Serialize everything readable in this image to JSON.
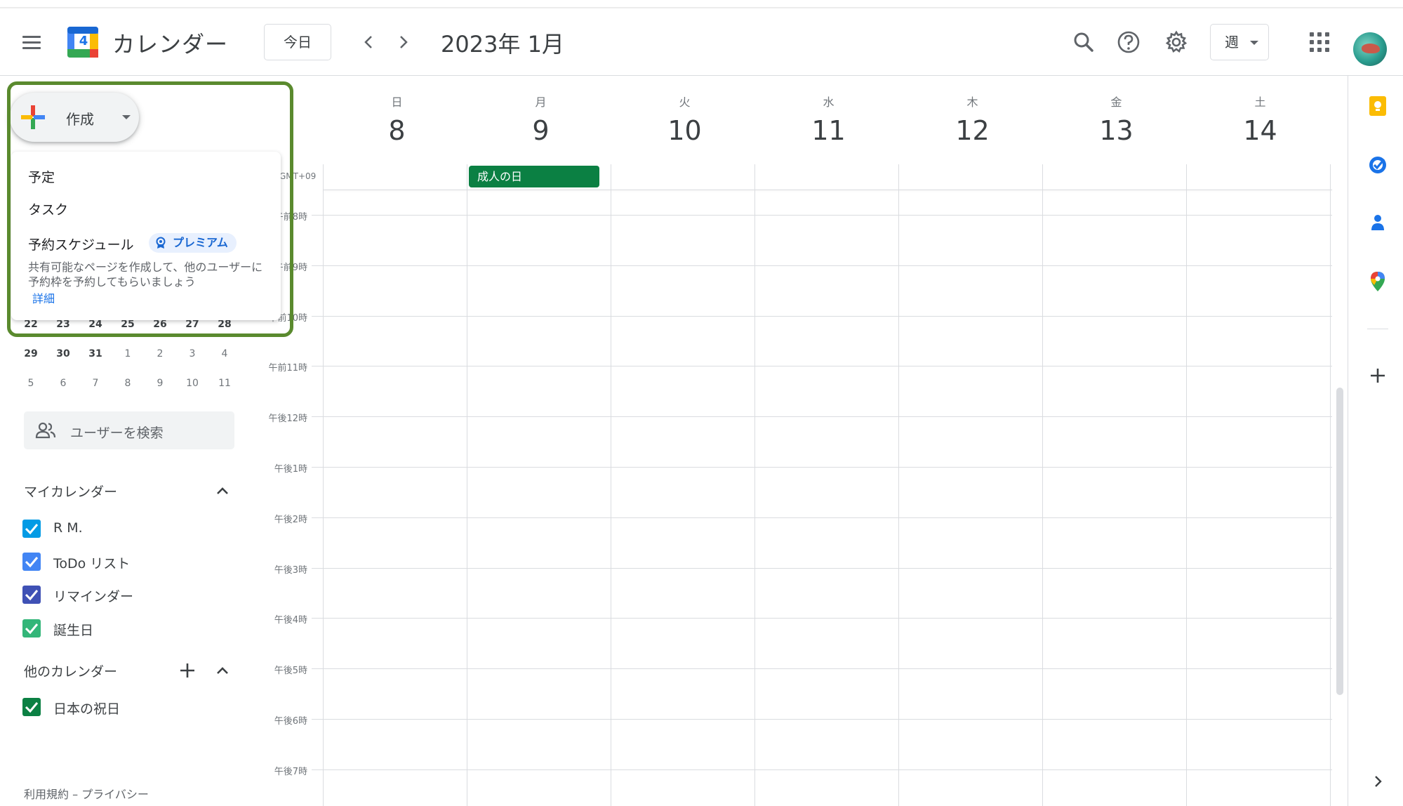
{
  "header": {
    "app_title": "カレンダー",
    "logo_day": "4",
    "today_label": "今日",
    "date_title": "2023年 1月",
    "view_label": "週"
  },
  "create": {
    "button_label": "作成",
    "menu": {
      "event": "予定",
      "task": "タスク",
      "appointment": "予約スケジュール",
      "premium_badge": "プレミアム",
      "description": "共有可能なページを作成して、他のユーザーに予約枠を予約してもらいましょう",
      "learn_more": "詳細"
    }
  },
  "mini_calendar": {
    "rows": [
      [
        "22",
        "23",
        "24",
        "25",
        "26",
        "27",
        "28"
      ],
      [
        "29",
        "30",
        "31",
        "1",
        "2",
        "3",
        "4"
      ],
      [
        "5",
        "6",
        "7",
        "8",
        "9",
        "10",
        "11"
      ]
    ]
  },
  "user_search": {
    "placeholder": "ユーザーを検索"
  },
  "my_calendars": {
    "title": "マイカレンダー",
    "items": [
      {
        "name": "R M.",
        "color": "#039be5"
      },
      {
        "name": "ToDo リスト",
        "color": "#4285f4"
      },
      {
        "name": "リマインダー",
        "color": "#3f51b5"
      },
      {
        "name": "誕生日",
        "color": "#33b679"
      }
    ]
  },
  "other_calendars": {
    "title": "他のカレンダー",
    "items": [
      {
        "name": "日本の祝日",
        "color": "#0b8043"
      }
    ]
  },
  "footer": {
    "links": "利用規約 – プライバシー"
  },
  "week": {
    "days": [
      {
        "dow": "日",
        "num": "8"
      },
      {
        "dow": "月",
        "num": "9"
      },
      {
        "dow": "火",
        "num": "10"
      },
      {
        "dow": "水",
        "num": "11"
      },
      {
        "dow": "木",
        "num": "12"
      },
      {
        "dow": "金",
        "num": "13"
      },
      {
        "dow": "土",
        "num": "14"
      }
    ],
    "timezone": "GMT+09",
    "hours": [
      "午前8時",
      "午前9時",
      "午前10時",
      "午前11時",
      "午後12時",
      "午後1時",
      "午後2時",
      "午後3時",
      "午後4時",
      "午後5時",
      "午後6時",
      "午後7時"
    ],
    "all_day_event": {
      "title": "成人の日",
      "day": "月",
      "color": "#0b8043"
    }
  },
  "colors": {
    "accent": "#1a73e8",
    "highlight_border": "#5a8a2e",
    "holiday_event": "#0b8043"
  },
  "side_panel": {
    "icons": [
      "keep-icon",
      "tasks-icon",
      "contacts-icon",
      "maps-icon",
      "add-addon-icon",
      "expand-panel-icon"
    ]
  }
}
